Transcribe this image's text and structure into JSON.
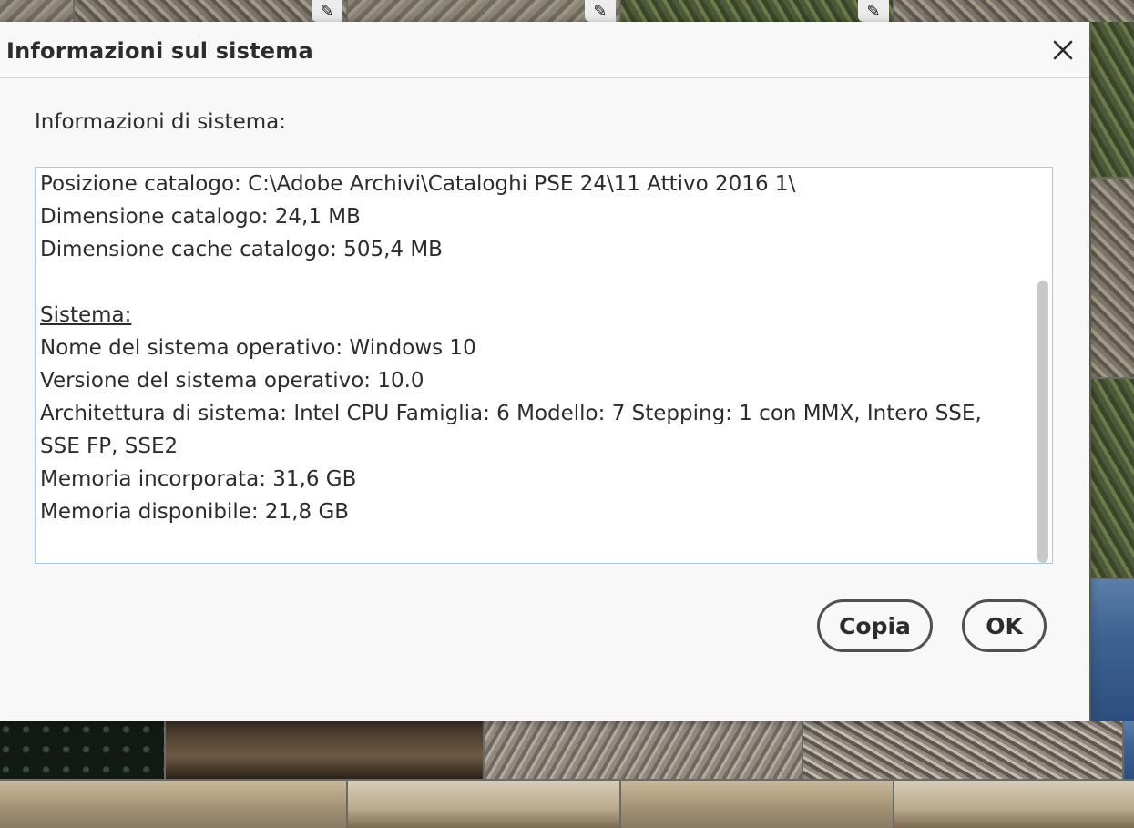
{
  "dialog": {
    "title": "Informazioni sul sistema",
    "close_icon": "close-icon",
    "info_label": "Informazioni di sistema:",
    "lines": {
      "catalog_position": "Posizione catalogo: C:\\Adobe Archivi\\Cataloghi PSE 24\\11 Attivo 2016 1\\",
      "catalog_size": "Dimensione catalogo: 24,1 MB",
      "catalog_cache_size": "Dimensione cache catalogo: 505,4 MB",
      "system_heading": "Sistema:",
      "os_name": "Nome del sistema operativo: Windows 10",
      "os_version": "Versione del sistema operativo: 10.0",
      "architecture": "Architettura di sistema: Intel CPU Famiglia: 6 Modello: 7 Stepping: 1 con MMX, Intero SSE, SSE FP, SSE2",
      "built_in_memory": "Memoria incorporata: 31,6 GB",
      "available_memory": "Memoria disponibile: 21,8 GB"
    },
    "buttons": {
      "copy": "Copia",
      "ok": "OK"
    }
  },
  "background": {
    "edit_badge_icon": "edit-pencil-icon"
  }
}
